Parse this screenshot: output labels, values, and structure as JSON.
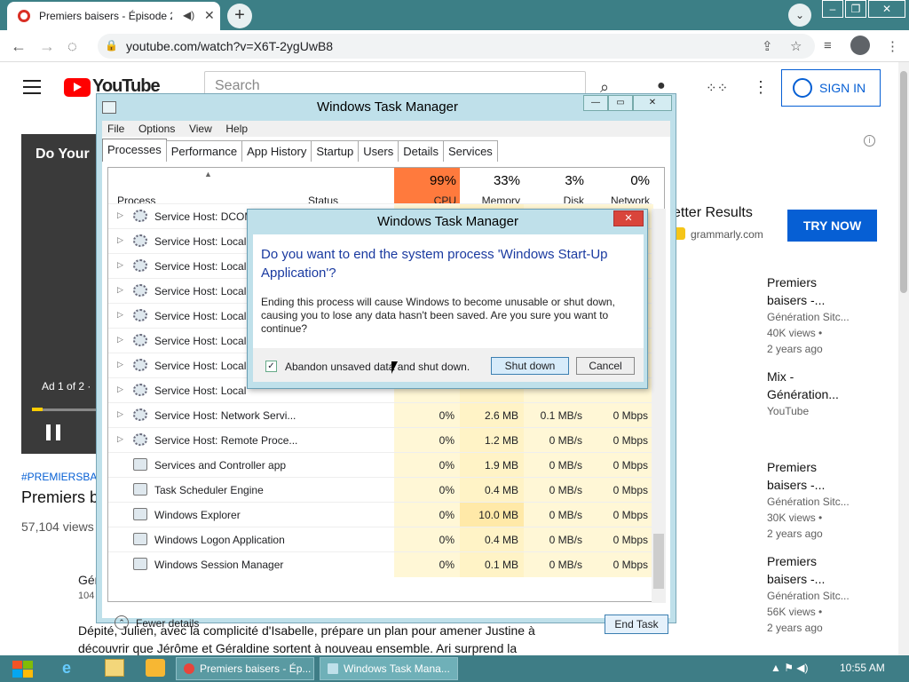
{
  "browser": {
    "tab_title": "Premiers baisers - Épisode 2",
    "url": "youtube.com/watch?v=X6T-2ygUwB8",
    "colors": {
      "frame": "#3c7f86"
    }
  },
  "youtube": {
    "logo": "YouTube",
    "search_placeholder": "Search",
    "sign_in": "SIGN IN",
    "video_overlay_title": "Do Your",
    "ad_label": "Ad 1 of 2 ·",
    "hashtag": "#PREMIERSBA",
    "title": "Premiers b",
    "views": "57,104 views",
    "channel": "Gén",
    "channel_subs": "104",
    "description": "Dépité, Julien, avec la complicité d'Isabelle, prépare un plan pour amener Justine à découvrir que Jérôme et Géraldine sortent à nouveau ensemble. Ari surprend la",
    "ad_headline": "etter Results",
    "ad_domain": "grammarly.com",
    "ad_cta": "TRY NOW",
    "recommendations": [
      {
        "title1": "Premiers",
        "title2": "baisers -...",
        "channel": "Génération Sitc...",
        "views": "40K views •",
        "age": "2 years ago"
      },
      {
        "title1": "Mix -",
        "title2": "Génération...",
        "channel": "YouTube",
        "views": "",
        "age": ""
      },
      {
        "title1": "Premiers",
        "title2": "baisers -...",
        "channel": "Génération Sitc...",
        "views": "30K views •",
        "age": "2 years ago"
      },
      {
        "title1": "Premiers",
        "title2": "baisers -...",
        "channel": "Génération Sitc...",
        "views": "56K views •",
        "age": "2 years ago"
      }
    ]
  },
  "taskmgr": {
    "title": "Windows Task Manager",
    "menu": [
      "File",
      "Options",
      "View",
      "Help"
    ],
    "tabs": [
      "Processes",
      "Performance",
      "App History",
      "Startup",
      "Users",
      "Details",
      "Services"
    ],
    "headers": {
      "process": "Process",
      "status": "Status",
      "cpu_pct": "99%",
      "cpu": "CPU",
      "mem_pct": "33%",
      "mem": "Memory",
      "disk_pct": "3%",
      "disk": "Disk",
      "net_pct": "0%",
      "net": "Network"
    },
    "rows": [
      {
        "name": "Service Host: DCOM",
        "cpu": "",
        "mem": "",
        "disk": "",
        "net": ""
      },
      {
        "name": "Service Host: Local",
        "cpu": "",
        "mem": "",
        "disk": "",
        "net": ""
      },
      {
        "name": "Service Host: Local",
        "cpu": "",
        "mem": "",
        "disk": "",
        "net": ""
      },
      {
        "name": "Service Host: Local",
        "cpu": "",
        "mem": "",
        "disk": "",
        "net": ""
      },
      {
        "name": "Service Host: Local",
        "cpu": "",
        "mem": "",
        "disk": "",
        "net": ""
      },
      {
        "name": "Service Host: Local",
        "cpu": "",
        "mem": "",
        "disk": "",
        "net": ""
      },
      {
        "name": "Service Host: Local",
        "cpu": "",
        "mem": "",
        "disk": "",
        "net": ""
      },
      {
        "name": "Service Host: Local",
        "cpu": "",
        "mem": "",
        "disk": "",
        "net": ""
      },
      {
        "name": "Service Host: Network Servi...",
        "cpu": "0%",
        "mem": "2.6 MB",
        "disk": "0.1 MB/s",
        "net": "0 Mbps"
      },
      {
        "name": "Service Host: Remote Proce...",
        "cpu": "0%",
        "mem": "1.2 MB",
        "disk": "0 MB/s",
        "net": "0 Mbps"
      },
      {
        "name": "Services and Controller app",
        "cpu": "0%",
        "mem": "1.9 MB",
        "disk": "0 MB/s",
        "net": "0 Mbps"
      },
      {
        "name": "Task Scheduler Engine",
        "cpu": "0%",
        "mem": "0.4 MB",
        "disk": "0 MB/s",
        "net": "0 Mbps"
      },
      {
        "name": "Windows Explorer",
        "cpu": "0%",
        "mem": "10.0 MB",
        "disk": "0 MB/s",
        "net": "0 Mbps"
      },
      {
        "name": "Windows Logon Application",
        "cpu": "0%",
        "mem": "0.4 MB",
        "disk": "0 MB/s",
        "net": "0 Mbps"
      },
      {
        "name": "Windows Session Manager",
        "cpu": "0%",
        "mem": "0.1 MB",
        "disk": "0 MB/s",
        "net": "0 Mbps"
      }
    ],
    "fewer_details": "Fewer details",
    "end_task": "End Task"
  },
  "dialog": {
    "title": "Windows Task Manager",
    "question": "Do you want to end the system process 'Windows Start-Up Application'?",
    "message": "Ending this process will cause Windows to become unusable or shut down, causing you to lose any data hasn't been saved. Are you sure you want to continue?",
    "checkbox_label": "Abandon unsaved data and shut down.",
    "checkbox_checked": true,
    "shut_down": "Shut down",
    "cancel": "Cancel"
  },
  "taskbar": {
    "task1": "Premiers baisers - Ép...",
    "task2": "Windows Task Mana...",
    "clock": "10:55 AM"
  }
}
